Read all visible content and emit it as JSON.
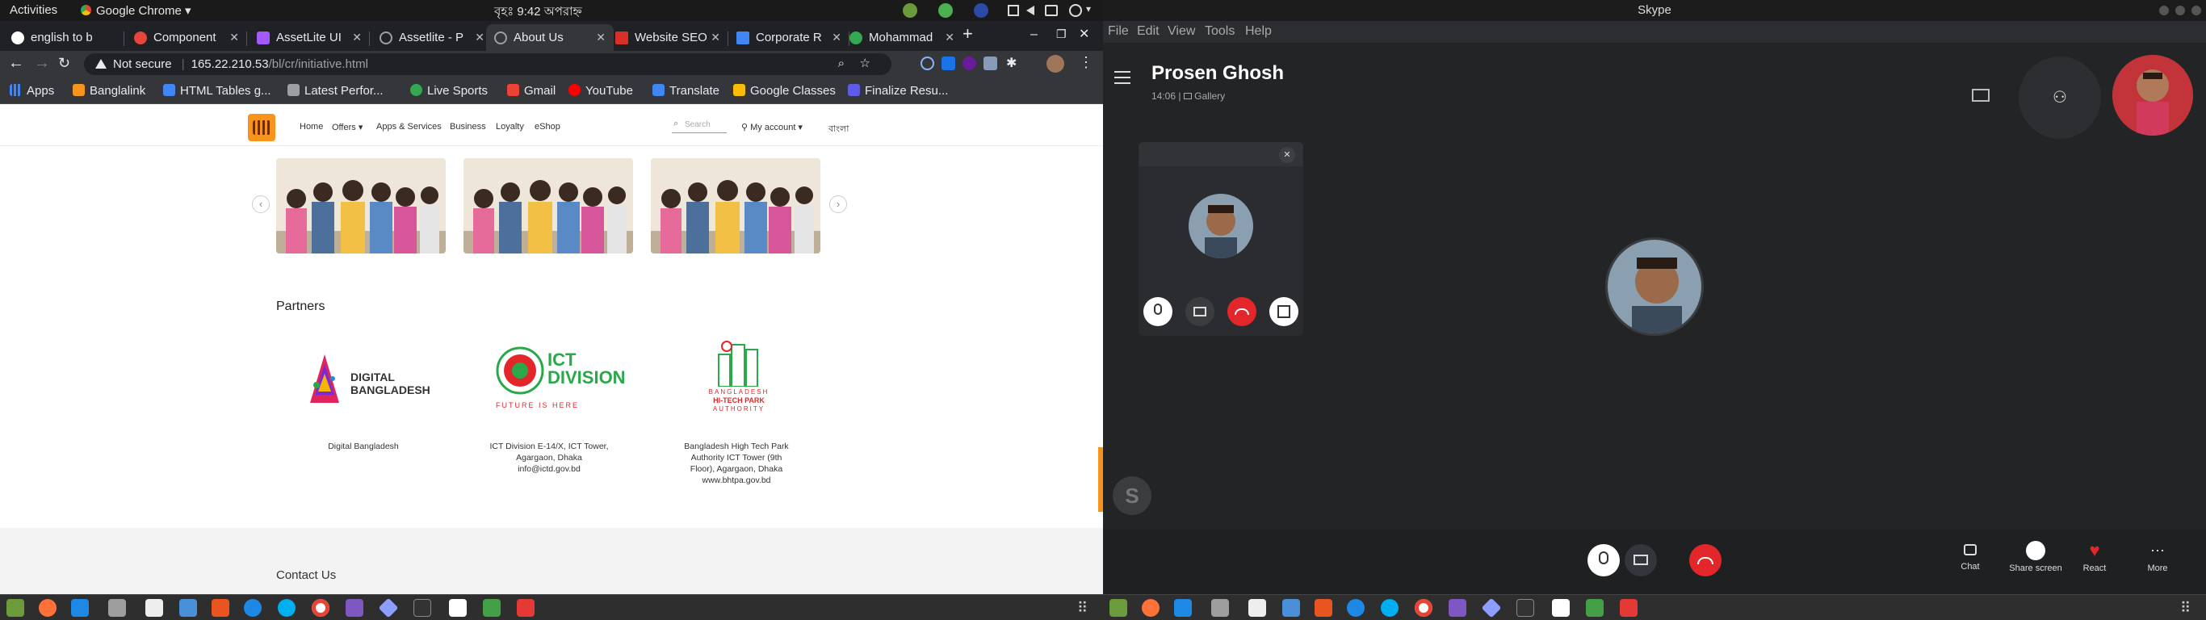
{
  "os_bar": {
    "activities": "Activities",
    "app": "Google Chrome",
    "clock": "বৃহঃ 9:42 অপরাহ্ন"
  },
  "chrome": {
    "tabs": [
      {
        "title": "english to b",
        "color": "#fff"
      },
      {
        "title": "Component",
        "color": "#e8453c"
      },
      {
        "title": "AssetLite UI",
        "color": "#a259ff"
      },
      {
        "title": "Assetlite - P",
        "color": "#9aa0a6"
      },
      {
        "title": "About Us",
        "color": "#9aa0a6"
      },
      {
        "title": "Website SEO",
        "color": "#d93025"
      },
      {
        "title": "Corporate R",
        "color": "#4285f4"
      },
      {
        "title": "Mohammad",
        "color": "#34a853"
      }
    ],
    "new_tab": "+",
    "security": "Not secure",
    "url_host": "165.22.210.53",
    "url_path": "/bl/cr/initiative.html",
    "bookmarks": [
      {
        "label": "Apps",
        "color": "#4285f4"
      },
      {
        "label": "Banglalink",
        "color": "#f7941d"
      },
      {
        "label": "HTML Tables g...",
        "color": "#4285f4"
      },
      {
        "label": "Latest Perfor...",
        "color": "#9aa0a6"
      },
      {
        "label": "Live Sports",
        "color": "#34a853"
      },
      {
        "label": "Gmail",
        "color": "#ea4335"
      },
      {
        "label": "YouTube",
        "color": "#ff0000"
      },
      {
        "label": "Translate",
        "color": "#4285f4"
      },
      {
        "label": "Google Classes",
        "color": "#fbbc04"
      },
      {
        "label": "Finalize Resu...",
        "color": "#5e5ce6"
      }
    ]
  },
  "site": {
    "nav": [
      "Home",
      "Offers",
      "Apps & Services",
      "Business",
      "Loyalty",
      "eShop"
    ],
    "search_placeholder": "Search",
    "account": "My account",
    "lang": "বাংলা",
    "partners_heading": "Partners",
    "partners": [
      {
        "name": "Digital Bangladesh",
        "logo_text": "DIGITAL BANGLADESH",
        "caption": [
          "Digital Bangladesh"
        ]
      },
      {
        "name": "ICT Division",
        "logo_text": "ICT DIVISION",
        "logo_sub": "FUTURE IS HERE",
        "caption": [
          "ICT Division E-14/X, ICT Tower,",
          "Agargaon, Dhaka",
          "info@ictd.gov.bd"
        ]
      },
      {
        "name": "Bangladesh Hi-Tech Park",
        "logo_text": "BANGLADESH",
        "logo_text2": "HI-TECH PARK",
        "logo_text3": "AUTHORITY",
        "caption": [
          "Bangladesh High Tech Park",
          "Authority ICT Tower (9th",
          "Floor), Agargaon, Dhaka",
          "www.bhtpa.gov.bd"
        ]
      }
    ],
    "contact_heading": "Contact Us"
  },
  "skype": {
    "window_title": "Skype",
    "menu": [
      "File",
      "Edit",
      "View",
      "Tools",
      "Help"
    ],
    "caller": "Prosen Ghosh",
    "call_time": "14:06",
    "view_mode": "Gallery",
    "actions": [
      {
        "label": "Chat"
      },
      {
        "label": "Share screen"
      },
      {
        "label": "React"
      },
      {
        "label": "More"
      }
    ],
    "logo_letter": "S"
  }
}
